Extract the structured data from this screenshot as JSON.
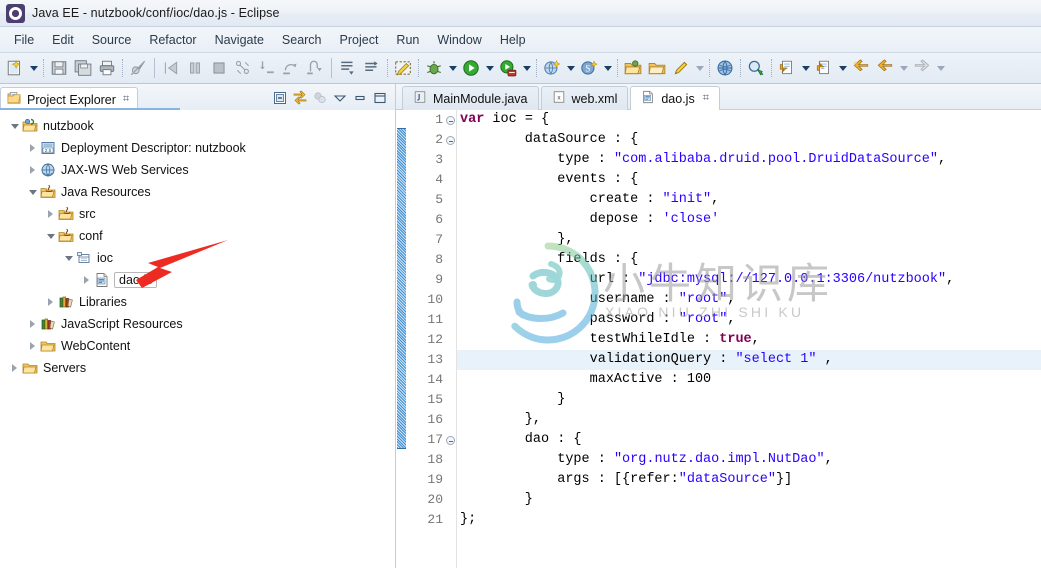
{
  "window": {
    "title": "Java EE - nutzbook/conf/ioc/dao.js - Eclipse",
    "app_icon": "eclipse-logo-icon"
  },
  "menubar": {
    "items": [
      {
        "label": "File"
      },
      {
        "label": "Edit"
      },
      {
        "label": "Source"
      },
      {
        "label": "Refactor"
      },
      {
        "label": "Navigate"
      },
      {
        "label": "Search"
      },
      {
        "label": "Project"
      },
      {
        "label": "Run"
      },
      {
        "label": "Window"
      },
      {
        "label": "Help"
      }
    ]
  },
  "toolbar": {
    "items": [
      {
        "name": "new-wizard-icon",
        "kind": "icon"
      },
      {
        "name": "new-wizard-dropdown-icon",
        "kind": "arrow"
      },
      {
        "name": "separator",
        "kind": "sep"
      },
      {
        "name": "save-icon",
        "kind": "icon"
      },
      {
        "name": "save-all-icon",
        "kind": "icon"
      },
      {
        "name": "print-icon",
        "kind": "icon"
      },
      {
        "name": "separator",
        "kind": "sep"
      },
      {
        "name": "toggle-breakpoint-icon",
        "kind": "icon"
      },
      {
        "name": "divider",
        "kind": "divider"
      },
      {
        "name": "resume-icon",
        "kind": "icon"
      },
      {
        "name": "suspend-icon",
        "kind": "icon"
      },
      {
        "name": "terminate-icon",
        "kind": "icon"
      },
      {
        "name": "disconnect-icon",
        "kind": "icon"
      },
      {
        "name": "step-into-icon",
        "kind": "icon"
      },
      {
        "name": "step-over-icon",
        "kind": "icon"
      },
      {
        "name": "step-return-icon",
        "kind": "icon"
      },
      {
        "name": "divider",
        "kind": "divider"
      },
      {
        "name": "next-annotation-icon",
        "kind": "icon"
      },
      {
        "name": "previous-annotation-icon",
        "kind": "icon"
      },
      {
        "name": "separator",
        "kind": "sep"
      },
      {
        "name": "toggle-mark-occurrences-icon",
        "kind": "icon"
      },
      {
        "name": "separator",
        "kind": "sep"
      },
      {
        "name": "debug-icon",
        "kind": "icon"
      },
      {
        "name": "debug-dropdown-icon",
        "kind": "arrow"
      },
      {
        "name": "run-icon",
        "kind": "icon"
      },
      {
        "name": "run-dropdown-icon",
        "kind": "arrow"
      },
      {
        "name": "run-on-server-icon",
        "kind": "icon"
      },
      {
        "name": "run-on-server-dropdown-icon",
        "kind": "arrow"
      },
      {
        "name": "separator",
        "kind": "sep"
      },
      {
        "name": "new-java-ee-project-icon",
        "kind": "icon"
      },
      {
        "name": "new-java-ee-dropdown-icon",
        "kind": "arrow"
      },
      {
        "name": "new-servlet-icon",
        "kind": "icon"
      },
      {
        "name": "new-servlet-dropdown-icon",
        "kind": "arrow"
      },
      {
        "name": "separator",
        "kind": "sep"
      },
      {
        "name": "open-type-icon",
        "kind": "icon"
      },
      {
        "name": "open-task-icon",
        "kind": "icon"
      },
      {
        "name": "pencil-icon",
        "kind": "icon"
      },
      {
        "name": "pencil-dropdown-icon",
        "kind": "arrow"
      },
      {
        "name": "separator",
        "kind": "sep"
      },
      {
        "name": "open-web-browser-icon",
        "kind": "icon"
      },
      {
        "name": "separator",
        "kind": "sep"
      },
      {
        "name": "search-icon",
        "kind": "icon"
      },
      {
        "name": "separator",
        "kind": "sep"
      },
      {
        "name": "next-edit-location-icon",
        "kind": "icon"
      },
      {
        "name": "next-edit-dropdown-icon",
        "kind": "arrow"
      },
      {
        "name": "previous-edit-location-icon",
        "kind": "icon"
      },
      {
        "name": "previous-edit-dropdown-icon",
        "kind": "arrow"
      },
      {
        "name": "back-star-icon",
        "kind": "icon"
      },
      {
        "name": "back-icon",
        "kind": "icon"
      },
      {
        "name": "back-dropdown-icon",
        "kind": "arrow"
      },
      {
        "name": "forward-icon",
        "kind": "icon"
      },
      {
        "name": "forward-dropdown-icon",
        "kind": "arrow"
      }
    ]
  },
  "explorer": {
    "tab_label": "Project Explorer",
    "tab_icon": "project-explorer-icon",
    "tab_close_glyph": "⌗",
    "tools": [
      {
        "name": "collapse-all-icon"
      },
      {
        "name": "link-with-editor-icon"
      },
      {
        "name": "view-menu-filter-icon"
      },
      {
        "name": "view-menu-icon"
      },
      {
        "name": "minimize-view-icon"
      },
      {
        "name": "maximize-view-icon"
      }
    ],
    "tree": [
      {
        "label": "nutzbook",
        "indent": 0,
        "twist": "open",
        "icon": "project-icon"
      },
      {
        "label": "Deployment Descriptor: nutzbook",
        "indent": 1,
        "twist": "closed",
        "icon": "deployment-descriptor-icon"
      },
      {
        "label": "JAX-WS Web Services",
        "indent": 1,
        "twist": "closed",
        "icon": "jaxws-icon"
      },
      {
        "label": "Java Resources",
        "indent": 1,
        "twist": "open",
        "icon": "java-resources-icon"
      },
      {
        "label": "src",
        "indent": 2,
        "twist": "closed",
        "icon": "source-folder-icon"
      },
      {
        "label": "conf",
        "indent": 2,
        "twist": "open",
        "icon": "source-folder-icon"
      },
      {
        "label": "ioc",
        "indent": 3,
        "twist": "open",
        "icon": "package-icon"
      },
      {
        "label": "dao.js",
        "indent": 4,
        "twist": "closed",
        "icon": "js-file-icon",
        "selected": true
      },
      {
        "label": "Libraries",
        "indent": 2,
        "twist": "closed",
        "icon": "libraries-icon"
      },
      {
        "label": "JavaScript Resources",
        "indent": 1,
        "twist": "closed",
        "icon": "libraries-icon"
      },
      {
        "label": "WebContent",
        "indent": 1,
        "twist": "closed",
        "icon": "folder-icon"
      },
      {
        "label": "Servers",
        "indent": 0,
        "twist": "closed",
        "icon": "folder-icon"
      }
    ]
  },
  "editor": {
    "tabs": [
      {
        "label": "MainModule.java",
        "icon": "java-file-icon",
        "active": false,
        "closable": false
      },
      {
        "label": "web.xml",
        "icon": "xml-file-icon",
        "active": false,
        "closable": false
      },
      {
        "label": "dao.js",
        "icon": "js-file-icon",
        "active": true,
        "closable": true
      }
    ],
    "close_glyph": "⌗",
    "current_line": 13,
    "fold_markers": [
      1,
      2,
      17
    ],
    "lines": [
      {
        "n": 1,
        "tokens": [
          {
            "t": "kw",
            "v": "var"
          },
          {
            "t": "p",
            "v": " ioc = {"
          }
        ]
      },
      {
        "n": 2,
        "tokens": [
          {
            "t": "p",
            "v": "        dataSource : {"
          }
        ]
      },
      {
        "n": 3,
        "tokens": [
          {
            "t": "p",
            "v": "            type : "
          },
          {
            "t": "str",
            "v": "\"com.alibaba.druid.pool.DruidDataSource\""
          },
          {
            "t": "p",
            "v": ","
          }
        ]
      },
      {
        "n": 4,
        "tokens": [
          {
            "t": "p",
            "v": "            events : {"
          }
        ]
      },
      {
        "n": 5,
        "tokens": [
          {
            "t": "p",
            "v": "                create : "
          },
          {
            "t": "str",
            "v": "\"init\""
          },
          {
            "t": "p",
            "v": ","
          }
        ]
      },
      {
        "n": 6,
        "tokens": [
          {
            "t": "p",
            "v": "                depose : "
          },
          {
            "t": "str",
            "v": "'close'"
          }
        ]
      },
      {
        "n": 7,
        "tokens": [
          {
            "t": "p",
            "v": "            },"
          }
        ]
      },
      {
        "n": 8,
        "tokens": [
          {
            "t": "p",
            "v": "            fields : {"
          }
        ]
      },
      {
        "n": 9,
        "tokens": [
          {
            "t": "p",
            "v": "                url : "
          },
          {
            "t": "str",
            "v": "\"jdbc:mysql://127.0.0.1:3306/nutzbook\""
          },
          {
            "t": "p",
            "v": ","
          }
        ]
      },
      {
        "n": 10,
        "tokens": [
          {
            "t": "p",
            "v": "                username : "
          },
          {
            "t": "str",
            "v": "\"root\""
          },
          {
            "t": "p",
            "v": ","
          }
        ]
      },
      {
        "n": 11,
        "tokens": [
          {
            "t": "p",
            "v": "                password : "
          },
          {
            "t": "str",
            "v": "\"root\""
          },
          {
            "t": "p",
            "v": ","
          }
        ]
      },
      {
        "n": 12,
        "tokens": [
          {
            "t": "p",
            "v": "                testWhileIdle : "
          },
          {
            "t": "kw",
            "v": "true"
          },
          {
            "t": "p",
            "v": ","
          }
        ]
      },
      {
        "n": 13,
        "tokens": [
          {
            "t": "p",
            "v": "                validationQuery : "
          },
          {
            "t": "str",
            "v": "\"select 1\""
          },
          {
            "t": "p",
            "v": " ,"
          }
        ]
      },
      {
        "n": 14,
        "tokens": [
          {
            "t": "p",
            "v": "                maxActive : 100"
          }
        ]
      },
      {
        "n": 15,
        "tokens": [
          {
            "t": "p",
            "v": "            }"
          }
        ]
      },
      {
        "n": 16,
        "tokens": [
          {
            "t": "p",
            "v": "        },"
          }
        ]
      },
      {
        "n": 17,
        "tokens": [
          {
            "t": "p",
            "v": "        dao : {"
          }
        ]
      },
      {
        "n": 18,
        "tokens": [
          {
            "t": "p",
            "v": "            type : "
          },
          {
            "t": "str",
            "v": "\"org.nutz.dao.impl.NutDao\""
          },
          {
            "t": "p",
            "v": ","
          }
        ]
      },
      {
        "n": 19,
        "tokens": [
          {
            "t": "p",
            "v": "            args : [{refer:"
          },
          {
            "t": "str",
            "v": "\"dataSource\""
          },
          {
            "t": "p",
            "v": "}]"
          }
        ]
      },
      {
        "n": 20,
        "tokens": [
          {
            "t": "p",
            "v": "        }"
          }
        ]
      },
      {
        "n": 21,
        "tokens": [
          {
            "t": "p",
            "v": "};"
          }
        ]
      }
    ]
  },
  "watermark": {
    "chinese": "小牛知识库",
    "english": "XIAO NIU ZHI SHI KU",
    "logo_name": "xiaoniu-circle-logo"
  },
  "annotation": {
    "arrow_name": "red-pointer-arrow",
    "arrow_color": "#ee2b22",
    "points_to": "ioc"
  },
  "colors": {
    "keyword": "#7f0055",
    "string": "#2a00ff",
    "current_line_highlight": "#e8f2fb",
    "chrome": "#e6edf5"
  }
}
